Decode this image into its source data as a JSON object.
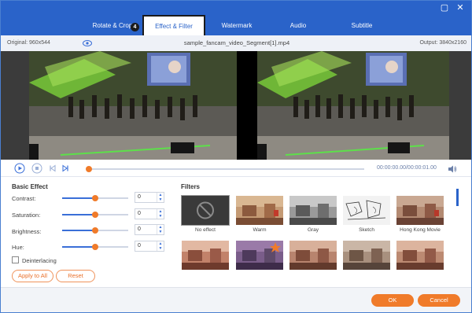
{
  "tabs": [
    {
      "label": "Rotate & Crop"
    },
    {
      "label": "Effect & Filter"
    },
    {
      "label": "Watermark"
    },
    {
      "label": "Audio"
    },
    {
      "label": "Subtitle"
    }
  ],
  "tab_badge": "4",
  "window_buttons": {
    "minimize": "▢",
    "close": "✕"
  },
  "info": {
    "original": "Original: 960x544",
    "filename": "sample_fancam_video_Segment[1].mp4",
    "output": "Output: 3840x2160"
  },
  "playback": {
    "time": "00:00:00.00/00:00:01.00",
    "progress": 0.0
  },
  "basic_effect": {
    "title": "Basic Effect",
    "adjustments": [
      {
        "label": "Contrast:",
        "value": "0",
        "level": 0.5
      },
      {
        "label": "Saturation:",
        "value": "0",
        "level": 0.5
      },
      {
        "label": "Brightness:",
        "value": "0",
        "level": 0.5
      },
      {
        "label": "Hue:",
        "value": "0",
        "level": 0.5
      }
    ],
    "deinterlacing": "Deinterlacing",
    "apply_all": "Apply to All",
    "reset": "Reset"
  },
  "filters": {
    "title": "Filters",
    "items": [
      {
        "label": "No effect",
        "icon": "no-effect-icon"
      },
      {
        "label": "Warm"
      },
      {
        "label": "Gray"
      },
      {
        "label": "Sketch"
      },
      {
        "label": "Hong Kong Movie"
      },
      {
        "label": ""
      },
      {
        "label": ""
      },
      {
        "label": ""
      },
      {
        "label": ""
      },
      {
        "label": ""
      }
    ]
  },
  "footer": {
    "ok": "OK",
    "cancel": "Cancel"
  },
  "colors": {
    "accent": "#2a63c9",
    "orange": "#f07b2a"
  }
}
